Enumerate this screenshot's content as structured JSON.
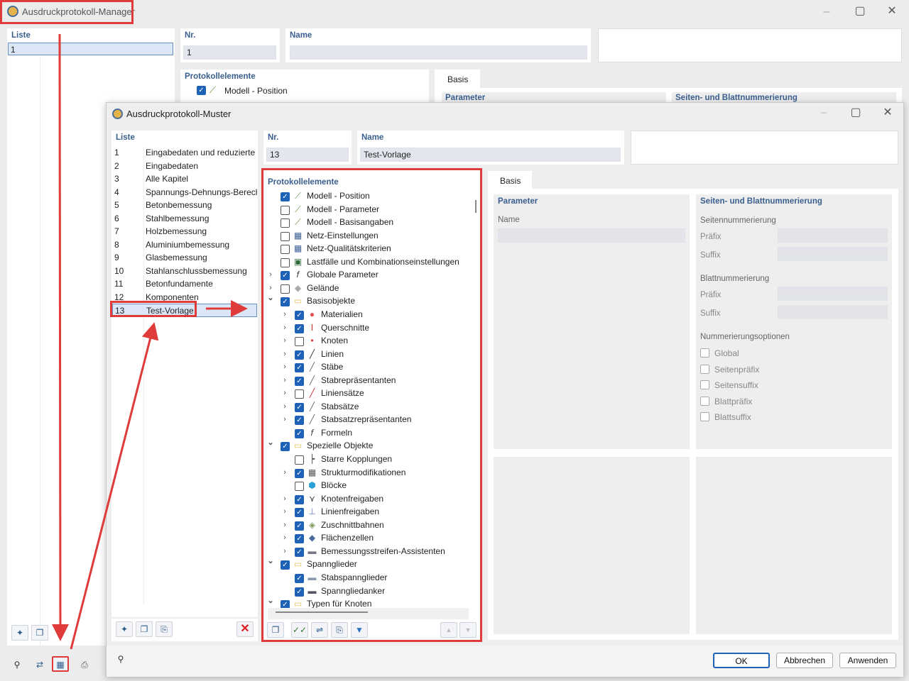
{
  "manager": {
    "title": "Ausdruckprotokoll-Manager",
    "list_header": "Liste",
    "list_selected": "1",
    "nr_label": "Nr.",
    "nr_value": "1",
    "name_label": "Name",
    "name_value": "",
    "elements_label": "Protokollelemente",
    "element_1": "Modell - Position",
    "tab_basis": "Basis",
    "param_label": "Parameter",
    "numbering_label": "Seiten- und Blattnummerierung"
  },
  "dialog": {
    "title": "Ausdruckprotokoll-Muster",
    "list_header": "Liste",
    "nr_label": "Nr.",
    "nr_value": "13",
    "name_label": "Name",
    "name_value": "Test-Vorlage",
    "elements_label": "Protokollelemente",
    "tab_basis": "Basis",
    "list": [
      {
        "nr": "1",
        "name": "Eingabedaten und reduzierte E"
      },
      {
        "nr": "2",
        "name": "Eingabedaten"
      },
      {
        "nr": "3",
        "name": "Alle Kapitel"
      },
      {
        "nr": "4",
        "name": "Spannungs-Dehnungs-Berechr"
      },
      {
        "nr": "5",
        "name": "Betonbemessung"
      },
      {
        "nr": "6",
        "name": "Stahlbemessung"
      },
      {
        "nr": "7",
        "name": "Holzbemessung"
      },
      {
        "nr": "8",
        "name": "Aluminiumbemessung"
      },
      {
        "nr": "9",
        "name": "Glasbemessung"
      },
      {
        "nr": "10",
        "name": "Stahlanschlussbemessung"
      },
      {
        "nr": "11",
        "name": "Betonfundamente"
      },
      {
        "nr": "12",
        "name": "Komponenten"
      },
      {
        "nr": "13",
        "name": "Test-Vorlage"
      }
    ],
    "tree": [
      {
        "label": "Modell - Position",
        "checked": true,
        "level": 0,
        "expander": "",
        "icon": "model-position-icon"
      },
      {
        "label": "Modell - Parameter",
        "checked": false,
        "level": 0,
        "expander": "",
        "icon": "model-parameter-icon"
      },
      {
        "label": "Modell - Basisangaben",
        "checked": false,
        "level": 0,
        "expander": "",
        "icon": "model-basic-icon"
      },
      {
        "label": "Netz-Einstellungen",
        "checked": false,
        "level": 0,
        "expander": "",
        "icon": "mesh-settings-icon"
      },
      {
        "label": "Netz-Qualitätskriterien",
        "checked": false,
        "level": 0,
        "expander": "",
        "icon": "mesh-quality-icon"
      },
      {
        "label": "Lastfälle und Kombinationseinstellungen",
        "checked": false,
        "level": 0,
        "expander": "",
        "icon": "load-cases-icon"
      },
      {
        "label": "Globale Parameter",
        "checked": true,
        "level": 0,
        "expander": "›",
        "icon": "formula-icon"
      },
      {
        "label": "Gelände",
        "checked": false,
        "level": 0,
        "expander": "›",
        "icon": "terrain-icon"
      },
      {
        "label": "Basisobjekte",
        "checked": true,
        "level": 0,
        "expander": "⌄",
        "icon": "folder-icon"
      },
      {
        "label": "Materialien",
        "checked": true,
        "level": 1,
        "expander": "›",
        "icon": "materials-icon"
      },
      {
        "label": "Querschnitte",
        "checked": true,
        "level": 1,
        "expander": "›",
        "icon": "cross-section-icon"
      },
      {
        "label": "Knoten",
        "checked": false,
        "level": 1,
        "expander": "›",
        "icon": "node-icon"
      },
      {
        "label": "Linien",
        "checked": true,
        "level": 1,
        "expander": "›",
        "icon": "line-icon"
      },
      {
        "label": "Stäbe",
        "checked": true,
        "level": 1,
        "expander": "›",
        "icon": "member-icon"
      },
      {
        "label": "Stabrepräsentanten",
        "checked": true,
        "level": 1,
        "expander": "›",
        "icon": "member-rep-icon"
      },
      {
        "label": "Liniensätze",
        "checked": false,
        "level": 1,
        "expander": "›",
        "icon": "line-set-icon"
      },
      {
        "label": "Stabsätze",
        "checked": true,
        "level": 1,
        "expander": "›",
        "icon": "member-set-icon"
      },
      {
        "label": "Stabsatzrepräsentanten",
        "checked": true,
        "level": 1,
        "expander": "›",
        "icon": "member-set-rep-icon"
      },
      {
        "label": "Formeln",
        "checked": true,
        "level": 1,
        "expander": "",
        "icon": "formula-icon"
      },
      {
        "label": "Spezielle Objekte",
        "checked": true,
        "level": 0,
        "expander": "⌄",
        "icon": "folder-icon"
      },
      {
        "label": "Starre Kopplungen",
        "checked": false,
        "level": 1,
        "expander": "",
        "icon": "rigid-link-icon"
      },
      {
        "label": "Strukturmodifikationen",
        "checked": true,
        "level": 1,
        "expander": "›",
        "icon": "structure-mod-icon"
      },
      {
        "label": "Blöcke",
        "checked": false,
        "level": 1,
        "expander": "",
        "icon": "block-icon"
      },
      {
        "label": "Knotenfreigaben",
        "checked": true,
        "level": 1,
        "expander": "›",
        "icon": "node-release-icon"
      },
      {
        "label": "Linienfreigaben",
        "checked": true,
        "level": 1,
        "expander": "›",
        "icon": "line-release-icon"
      },
      {
        "label": "Zuschnittbahnen",
        "checked": true,
        "level": 1,
        "expander": "›",
        "icon": "cutting-pattern-icon"
      },
      {
        "label": "Flächenzellen",
        "checked": true,
        "level": 1,
        "expander": "›",
        "icon": "surface-cell-icon"
      },
      {
        "label": "Bemessungsstreifen-Assistenten",
        "checked": true,
        "level": 1,
        "expander": "›",
        "icon": "design-strip-icon"
      },
      {
        "label": "Spannglieder",
        "checked": true,
        "level": 0,
        "expander": "⌄",
        "icon": "folder-icon"
      },
      {
        "label": "Stabspannglieder",
        "checked": true,
        "level": 1,
        "expander": "",
        "icon": "member-tendon-icon"
      },
      {
        "label": "Spanngliedanker",
        "checked": true,
        "level": 1,
        "expander": "",
        "icon": "tendon-anchor-icon"
      },
      {
        "label": "Typen für Knoten",
        "checked": true,
        "level": 0,
        "expander": "⌄",
        "icon": "folder-icon"
      }
    ],
    "param_label": "Parameter",
    "param_name_label": "Name",
    "numbering_label": "Seiten- und Blattnummerierung",
    "page_numbering": "Seitennummerierung",
    "prefix1": "Präfix",
    "suffix1": "Suffix",
    "sheet_numbering": "Blattnummerierung",
    "prefix2": "Präfix",
    "suffix2": "Suffix",
    "options_label": "Nummerierungsoptionen",
    "options": [
      "Global",
      "Seitenpräfix",
      "Seitensuffix",
      "Blattpräfix",
      "Blattsuffix"
    ],
    "ok": "OK",
    "cancel": "Abbrechen",
    "apply": "Anwenden"
  },
  "colors": {
    "accent": "#1e62b8",
    "annotation": "#e03b3b",
    "label": "#3a5f8f"
  }
}
